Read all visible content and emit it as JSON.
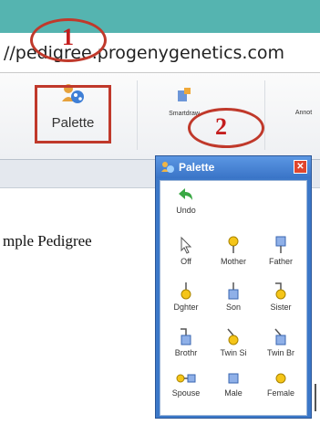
{
  "browser": {
    "url": "//pedigree.progenygenetics.com"
  },
  "toolbar": {
    "palette_label": "Palette",
    "smartdraw_label": "Smartdraw",
    "annotate_label": "Annot"
  },
  "annotations": {
    "step1": "1",
    "step2": "2"
  },
  "document": {
    "title": "mple Pedigree"
  },
  "palette_window": {
    "title": "Palette",
    "close": "✕",
    "items": [
      {
        "label": "Undo",
        "icon": "undo-arrow-icon"
      },
      {
        "label": "Off",
        "icon": "cursor-icon"
      },
      {
        "label": "Mother",
        "icon": "mother-icon"
      },
      {
        "label": "Father",
        "icon": "father-icon"
      },
      {
        "label": "Dghter",
        "icon": "daughter-icon"
      },
      {
        "label": "Son",
        "icon": "son-icon"
      },
      {
        "label": "Sister",
        "icon": "sister-icon"
      },
      {
        "label": "Brothr",
        "icon": "brother-icon"
      },
      {
        "label": "Twin Si",
        "icon": "twin-sister-icon"
      },
      {
        "label": "Twin Br",
        "icon": "twin-brother-icon"
      },
      {
        "label": "Spouse",
        "icon": "spouse-icon"
      },
      {
        "label": "Male",
        "icon": "male-icon"
      },
      {
        "label": "Female",
        "icon": "female-icon"
      }
    ]
  },
  "colors": {
    "annotation": "#c0392b",
    "palette_title": "#3c78c8",
    "female_symbol": "#f5c518",
    "male_symbol": "#4a7fd0",
    "undo_arrow": "#3aa845"
  }
}
